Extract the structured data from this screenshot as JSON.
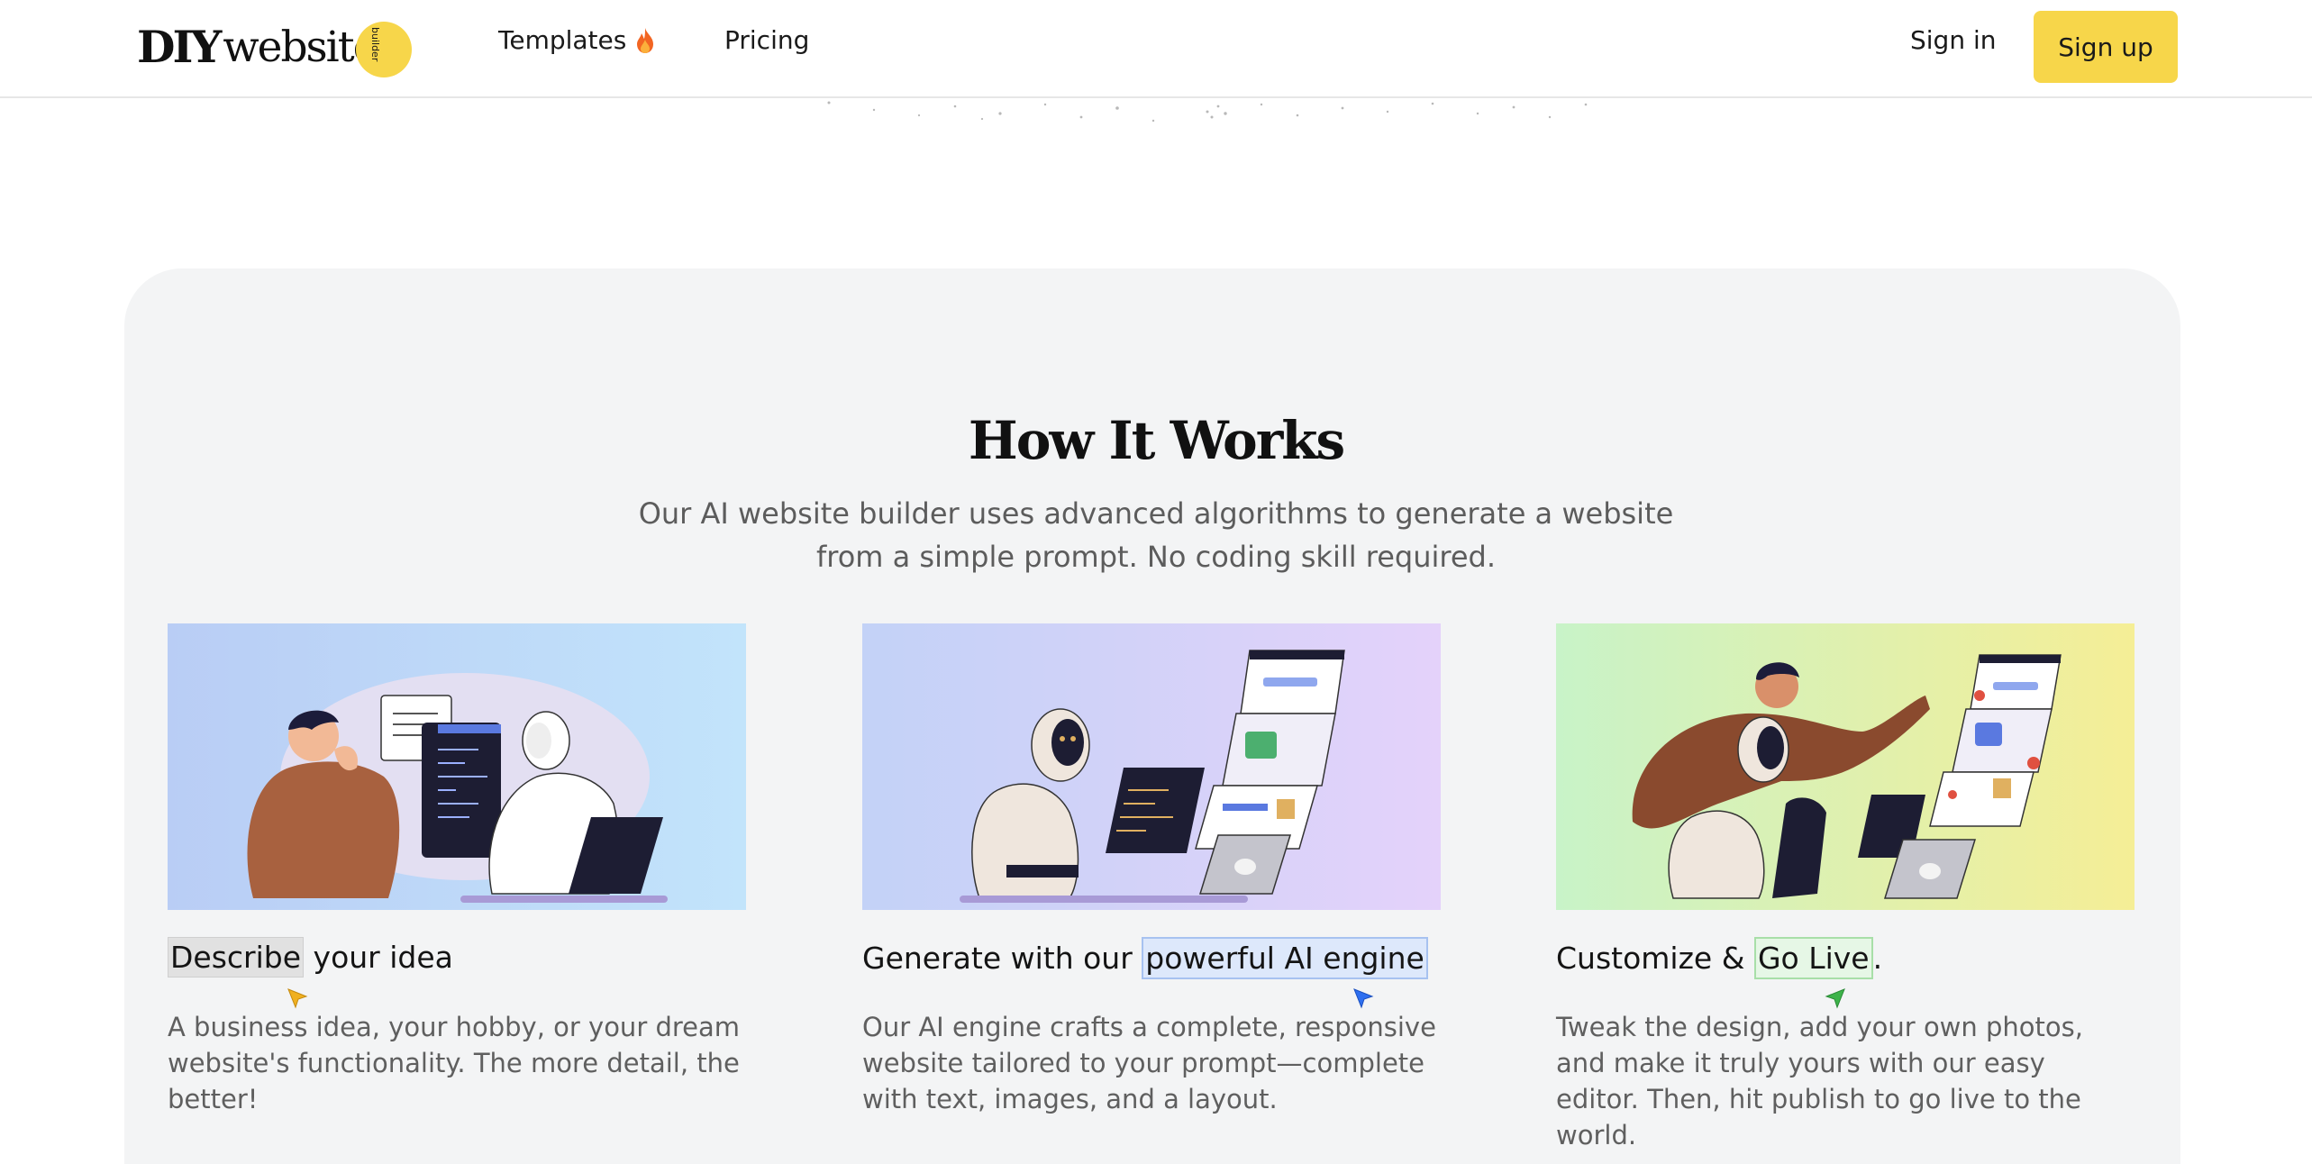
{
  "header": {
    "logo_primary": "DIY",
    "logo_secondary": "website",
    "logo_badge": "builder",
    "nav": [
      {
        "label": "Templates",
        "icon": "fire-icon"
      },
      {
        "label": "Pricing"
      }
    ],
    "sign_in_label": "Sign in",
    "sign_up_label": "Sign up"
  },
  "how_it_works": {
    "title": "How It Works",
    "subtitle": "Our AI website builder uses advanced algorithms to generate a website from a simple prompt. No coding skill required.",
    "steps": [
      {
        "title_highlight": "Describe",
        "title_rest": " your idea",
        "description": "A business idea, your hobby, or your dream website's functionality. The more detail, the better!",
        "illustration": "person-talking-to-robot"
      },
      {
        "title_start": "Generate with our ",
        "title_highlight": "powerful AI engine",
        "description": "Our AI engine crafts a complete, responsive website tailored to your prompt—complete with text, images, and a layout.",
        "illustration": "robot-with-laptop-and-pages"
      },
      {
        "title_start": "Customize & ",
        "title_highlight": "Go Live",
        "title_end": ".",
        "description": "Tweak the design, add your own photos, and make it truly yours with our easy editor. Then, hit publish to go live to the world.",
        "illustration": "person-and-robot-editing-site"
      }
    ]
  },
  "colors": {
    "brand_yellow": "#f7d64a",
    "section_bg": "#f3f4f5",
    "cursor_yellow": "#f0b020",
    "cursor_blue": "#2e6ff0",
    "cursor_green": "#3db34a"
  }
}
